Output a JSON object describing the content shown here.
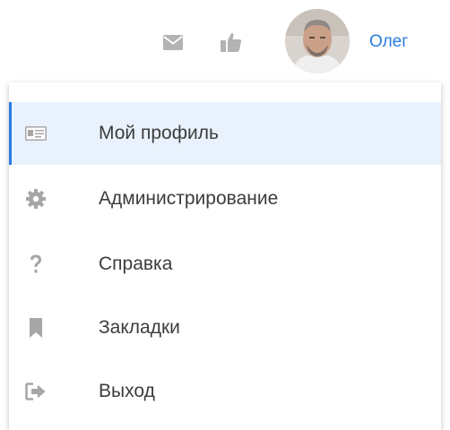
{
  "header": {
    "mail_icon": "envelope-icon",
    "like_icon": "thumbs-up-icon",
    "user_name": "Олег"
  },
  "menu": {
    "items": [
      {
        "label": "Мой профиль",
        "icon": "id-card-icon",
        "active": true
      },
      {
        "label": "Администрирование",
        "icon": "gear-icon",
        "active": false
      },
      {
        "label": "Справка",
        "icon": "question-mark-icon",
        "active": false
      },
      {
        "label": "Закладки",
        "icon": "bookmark-icon",
        "active": false
      },
      {
        "label": "Выход",
        "icon": "sign-out-icon",
        "active": false
      }
    ]
  },
  "colors": {
    "accent": "#2a7be0",
    "icon_gray": "#a6a6a6",
    "active_bg": "#e9f2fc",
    "text": "#3c3c3c"
  }
}
